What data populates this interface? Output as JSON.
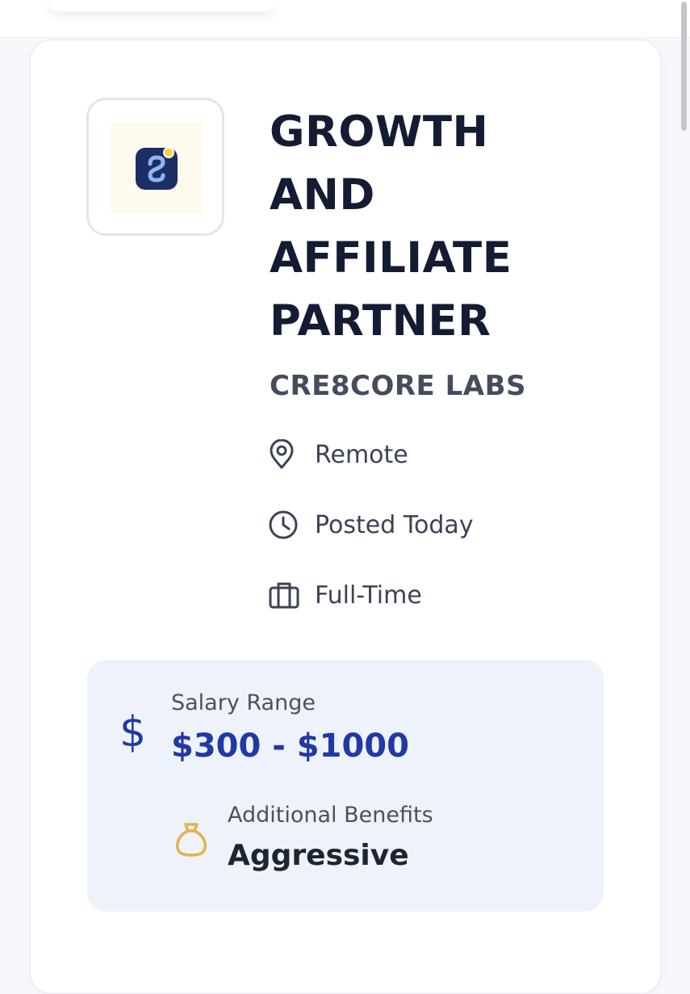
{
  "job": {
    "title": "GROWTH AND AFFILIATE PARTNER",
    "company": "CRE8CORE LABS",
    "location": "Remote",
    "posted": "Posted Today",
    "employment_type": "Full-Time"
  },
  "salary": {
    "label": "Salary Range",
    "value": "$300 - $1000",
    "icon": "dollar-icon"
  },
  "benefits": {
    "label": "Additional Benefits",
    "value": "Aggressive",
    "icon": "money-bag-icon"
  },
  "icons": {
    "location": "map-pin-icon",
    "posted": "clock-icon",
    "type": "briefcase-icon",
    "logo": "company-logo"
  },
  "colors": {
    "title": "#141c33",
    "accent_blue": "#2238a3",
    "salary_bg": "#edf2fb",
    "bag_gold": "#e0b44c",
    "logo_navy": "#1c2e63",
    "logo_yellow": "#f5d04a"
  }
}
